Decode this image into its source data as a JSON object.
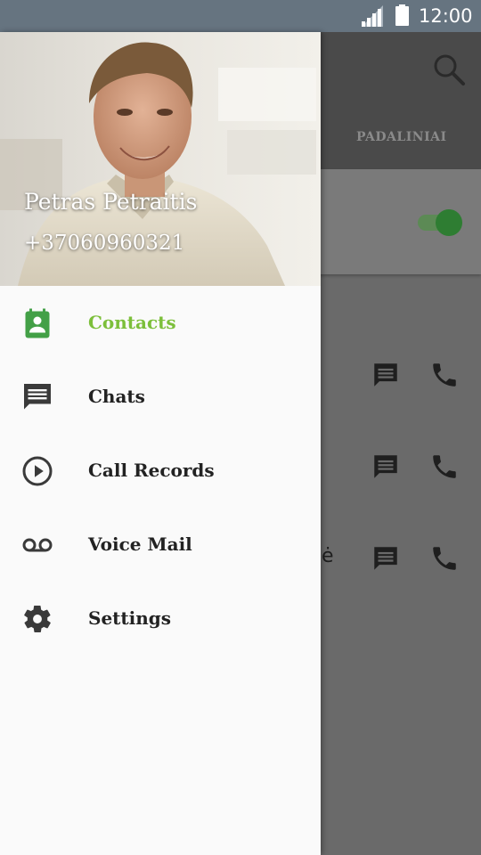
{
  "status_bar": {
    "time": "12:00",
    "icons": [
      "signal-icon",
      "battery-icon"
    ]
  },
  "background_screen": {
    "tab_label": "PADALINIAI",
    "toggle_on": true,
    "trailing_text": "ė",
    "icons": [
      "search-icon",
      "message-icon",
      "phone-icon"
    ]
  },
  "drawer": {
    "user": {
      "name": "Petras Petraitis",
      "phone": "+37060960321"
    },
    "menu": [
      {
        "label": "Contacts",
        "icon": "contacts-icon",
        "active": true
      },
      {
        "label": "Chats",
        "icon": "chat-icon",
        "active": false
      },
      {
        "label": "Call Records",
        "icon": "play-circle-icon",
        "active": false
      },
      {
        "label": "Voice Mail",
        "icon": "voicemail-icon",
        "active": false
      },
      {
        "label": "Settings",
        "icon": "gear-icon",
        "active": false
      }
    ]
  },
  "colors": {
    "accent": "#7cbf3a",
    "active_icon": "#43a047",
    "status_bar": "#667480",
    "drawer_bg": "#fafafa",
    "text": "#222222"
  }
}
